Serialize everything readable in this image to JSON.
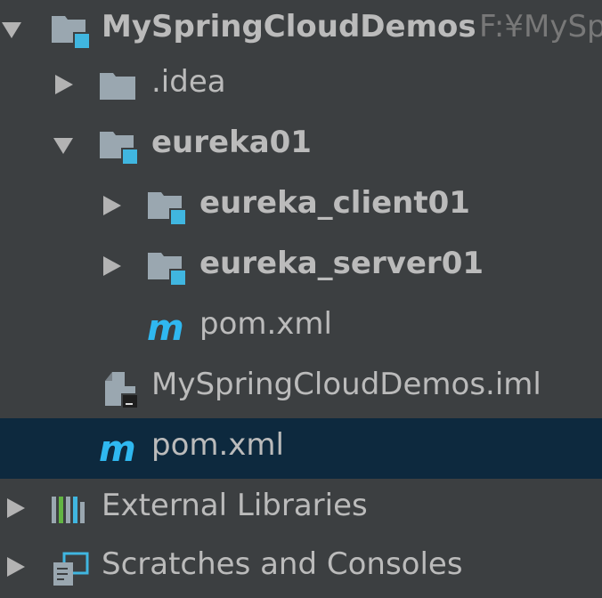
{
  "project_tree": {
    "root": {
      "label": "MySpringCloudDemos",
      "path": "F:¥MySp",
      "icon": "module-folder-icon",
      "state": "expanded"
    },
    "idea": {
      "label": ".idea",
      "icon": "folder-icon",
      "state": "collapsed"
    },
    "eureka01": {
      "label": "eureka01",
      "icon": "module-folder-icon",
      "state": "expanded"
    },
    "eureka_client01": {
      "label": "eureka_client01",
      "icon": "module-folder-icon",
      "state": "collapsed"
    },
    "eureka_server01": {
      "label": "eureka_server01",
      "icon": "module-folder-icon",
      "state": "collapsed"
    },
    "eureka01_pom": {
      "label": "pom.xml",
      "icon": "maven-icon"
    },
    "iml": {
      "label": "MySpringCloudDemos.iml",
      "icon": "iml-file-icon"
    },
    "root_pom": {
      "label": "pom.xml",
      "icon": "maven-icon",
      "selected": true
    },
    "external_libraries": {
      "label": "External Libraries",
      "icon": "libraries-icon",
      "state": "collapsed"
    },
    "scratches": {
      "label": "Scratches and Consoles",
      "icon": "scratches-icon",
      "state": "collapsed"
    }
  },
  "colors": {
    "background": "#3c3f41",
    "selection": "#0d293e",
    "text": "#bbbbbb",
    "path_text": "#787878",
    "folder_gray": "#9aa7b0",
    "module_blue": "#40b6e0",
    "maven_blue": "#2fb8f0"
  }
}
